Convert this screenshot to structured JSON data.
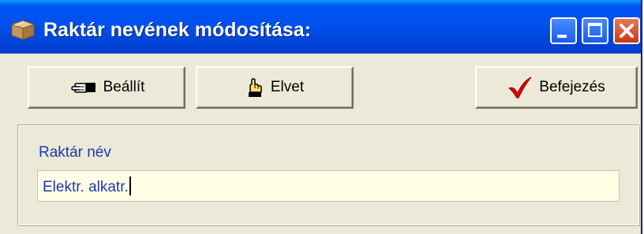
{
  "window": {
    "title": "Raktár nevének módosítása:"
  },
  "toolbar": {
    "set_label": "Beállít",
    "cancel_label": "Elvet",
    "finish_label": "Befejezés"
  },
  "form": {
    "name_label": "Raktár név",
    "name_value": "Elektr. alkatr."
  },
  "icons": {
    "app": "box-icon",
    "set": "pointing-hand-icon",
    "cancel": "raised-hand-icon",
    "finish": "checkmark-icon"
  },
  "colors": {
    "titlebar": "#0053ee",
    "label_text": "#1a3ab0",
    "input_background": "#ffffe6",
    "checkmark": "#e00000"
  }
}
